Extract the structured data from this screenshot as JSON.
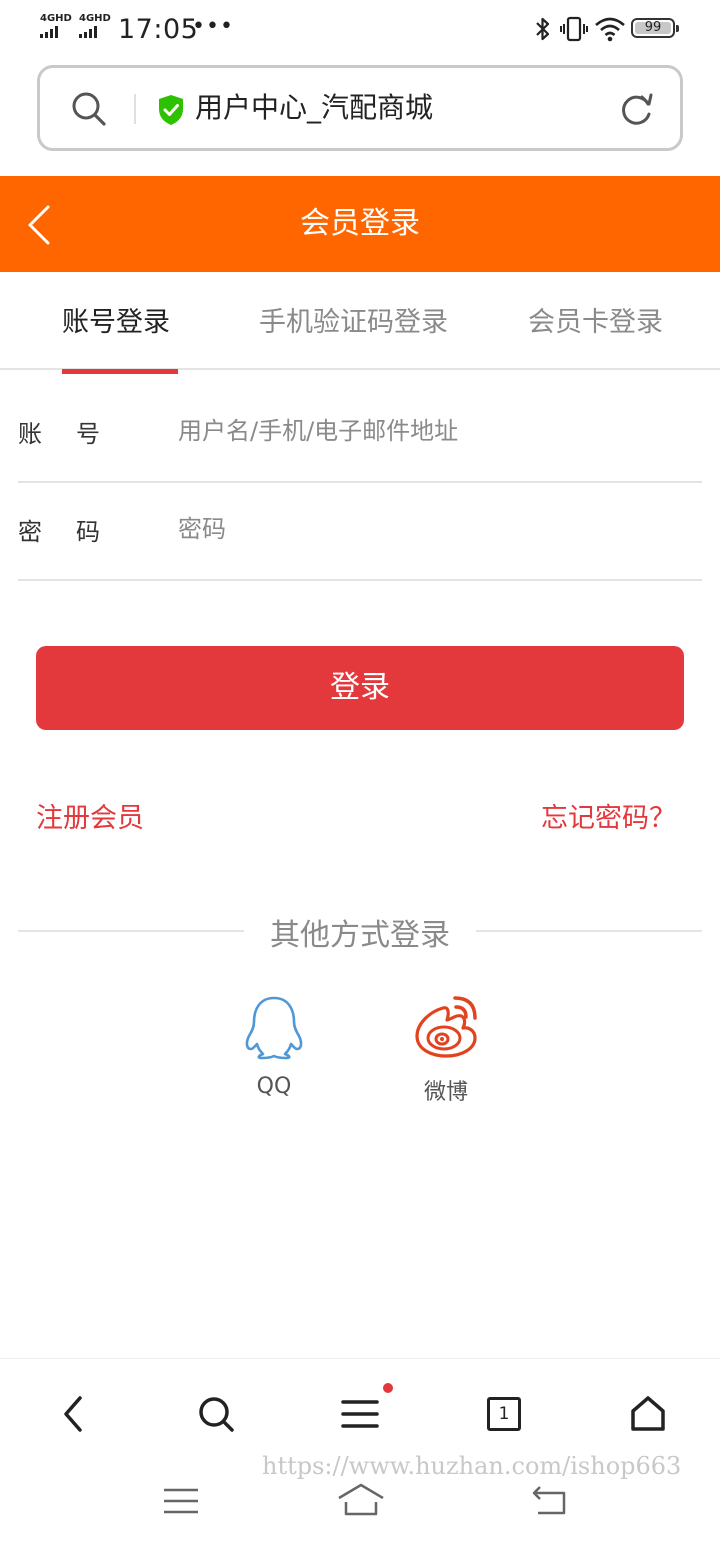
{
  "status_bar": {
    "signal_1": "4GHD",
    "signal_2": "4GHD",
    "time": "17:05",
    "more": "•••",
    "battery": "99"
  },
  "browser": {
    "page_title": "用户中心_汽配商城"
  },
  "header": {
    "title": "会员登录"
  },
  "tabs": [
    {
      "label": "账号登录",
      "active": true
    },
    {
      "label": "手机验证码登录",
      "active": false
    },
    {
      "label": "会员卡登录",
      "active": false
    }
  ],
  "form": {
    "account_label": "账号",
    "account_placeholder": "用户名/手机/电子邮件地址",
    "password_label": "密码",
    "password_placeholder": "密码",
    "login_button": "登录"
  },
  "links": {
    "register": "注册会员",
    "forgot": "忘记密码？"
  },
  "other_login": {
    "title": "其他方式登录",
    "options": [
      {
        "label": "QQ",
        "icon": "qq-icon"
      },
      {
        "label": "微博",
        "icon": "weibo-icon"
      }
    ]
  },
  "bottom_nav": {
    "tab_count": "1"
  },
  "watermark": "https://www.huzhan.com/ishop663",
  "colors": {
    "header": "#ff6600",
    "accent": "#e4393c",
    "secure": "#2dc100"
  }
}
